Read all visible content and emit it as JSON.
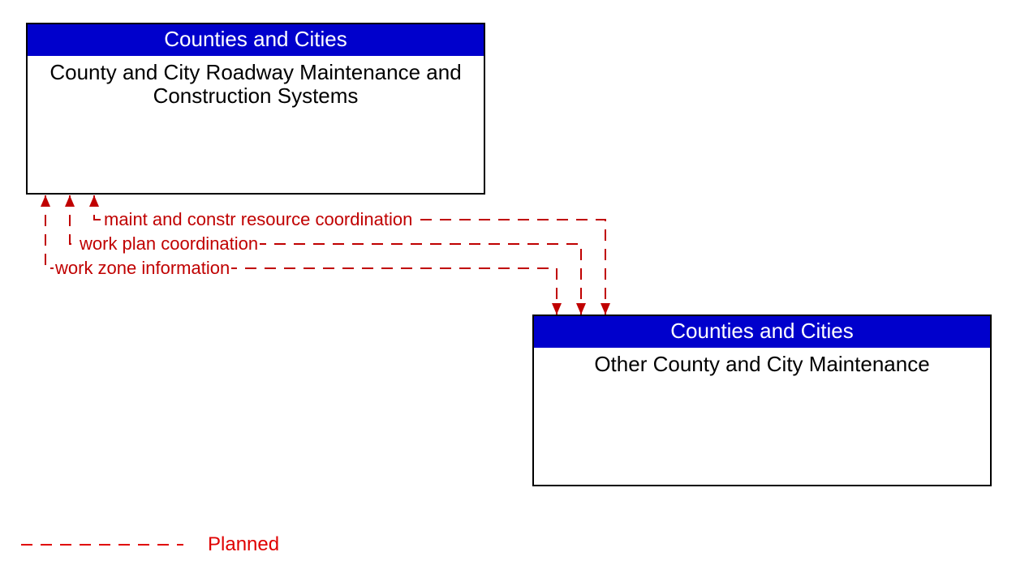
{
  "boxes": {
    "top": {
      "header": "Counties and Cities",
      "body": "County and City Roadway Maintenance and Construction Systems"
    },
    "bottom": {
      "header": "Counties and Cities",
      "body": "Other County and City Maintenance"
    }
  },
  "flows": {
    "f1": "maint and constr resource coordination",
    "f2": "work plan coordination",
    "f3": "work zone information"
  },
  "legend": {
    "planned": "Planned"
  },
  "colors": {
    "header_bg": "#0000cc",
    "flow": "#c00000"
  }
}
